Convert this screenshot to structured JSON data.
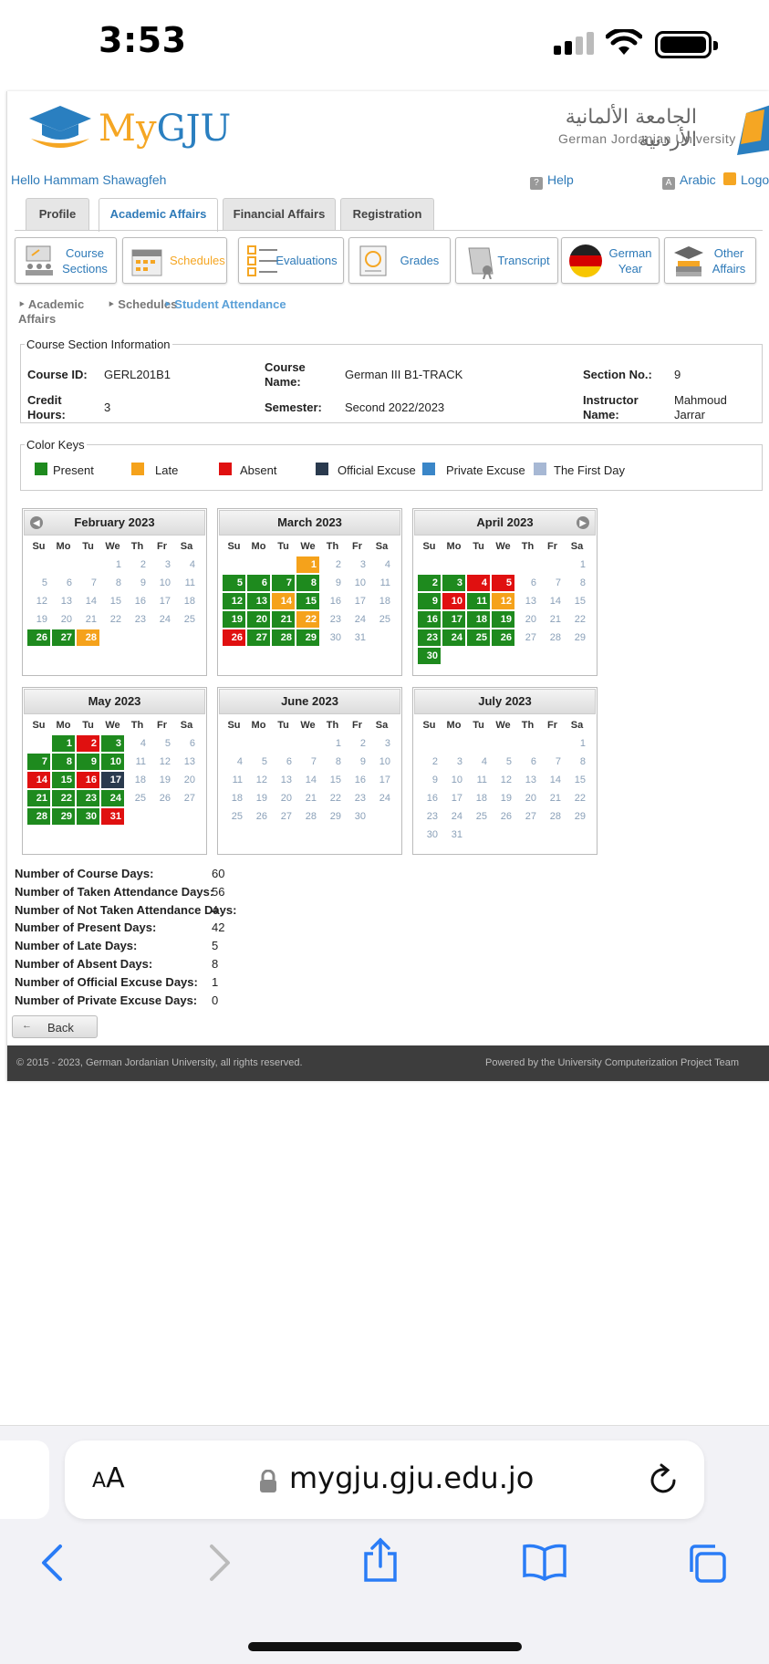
{
  "status_bar": {
    "time": "3:53"
  },
  "header": {
    "logo_my": "My",
    "logo_gju": "GJU",
    "university_ar": "الجامعة الألمانية الأردنية",
    "university_en": "German Jordanian University"
  },
  "user_bar": {
    "greeting": "Hello Hammam Shawagfeh",
    "help": "Help",
    "arabic": "Arabic",
    "logout": "Logo"
  },
  "tabs": [
    {
      "label": "Profile"
    },
    {
      "label": "Academic Affairs",
      "active": true
    },
    {
      "label": "Financial Affairs"
    },
    {
      "label": "Registration"
    }
  ],
  "shortcuts": [
    {
      "label": "Course Sections",
      "icon": "course-sections-icon"
    },
    {
      "label": "Schedules",
      "icon": "calendar-icon"
    },
    {
      "label": "Evaluations",
      "icon": "checklist-icon"
    },
    {
      "label": "Grades",
      "icon": "certificate-icon"
    },
    {
      "label": "Transcript",
      "icon": "scroll-icon"
    },
    {
      "label": "German Year",
      "icon": "german-flag-icon"
    },
    {
      "label": "Other Affairs",
      "icon": "books-icon"
    }
  ],
  "breadcrumb": {
    "item1": "Academic Affairs",
    "item2": "Schedules",
    "current": "Student Attendance"
  },
  "course_info": {
    "legend": "Course Section Information",
    "course_id_label": "Course ID:",
    "course_id": "GERL201B1",
    "course_name_label": "Course Name:",
    "course_name": "German III B1-TRACK",
    "section_label": "Section No.:",
    "section": "9",
    "credit_label": "Credit Hours:",
    "credit": "3",
    "semester_label": "Semester:",
    "semester": "Second 2022/2023",
    "instructor_label": "Instructor Name:",
    "instructor": "Mahmoud Jarrar"
  },
  "color_keys": {
    "legend": "Color Keys",
    "items": [
      {
        "label": "Present",
        "color": "#1e8a1e"
      },
      {
        "label": "Late",
        "color": "#f5a21b"
      },
      {
        "label": "Absent",
        "color": "#e01010"
      },
      {
        "label": "Official Excuse",
        "color": "#2a3a4e"
      },
      {
        "label": "Private Excuse",
        "color": "#3a86c8"
      },
      {
        "label": "The First Day",
        "color": "#a7b8d4"
      }
    ]
  },
  "calendar_days": [
    "Su",
    "Mo",
    "Tu",
    "We",
    "Th",
    "Fr",
    "Sa"
  ],
  "months": [
    {
      "title": "February 2023",
      "start": 3,
      "days": 28,
      "marks": {
        "26": "P",
        "27": "P",
        "28": "L"
      }
    },
    {
      "title": "March 2023",
      "start": 3,
      "days": 31,
      "marks": {
        "1": "L",
        "5": "P",
        "6": "P",
        "7": "P",
        "8": "P",
        "12": "P",
        "13": "P",
        "14": "L",
        "15": "P",
        "19": "P",
        "20": "P",
        "21": "P",
        "22": "L",
        "26": "A",
        "27": "P",
        "28": "P",
        "29": "P"
      }
    },
    {
      "title": "April 2023",
      "start": 6,
      "days": 30,
      "marks": {
        "2": "P",
        "3": "P",
        "4": "A",
        "5": "A",
        "9": "P",
        "10": "A",
        "11": "P",
        "12": "L",
        "16": "P",
        "17": "P",
        "18": "P",
        "19": "P",
        "23": "P",
        "24": "P",
        "25": "P",
        "26": "P",
        "30": "P"
      }
    },
    {
      "title": "May 2023",
      "start": 1,
      "days": 31,
      "marks": {
        "1": "P",
        "2": "A",
        "3": "P",
        "7": "P",
        "8": "P",
        "9": "P",
        "10": "P",
        "14": "A",
        "15": "P",
        "16": "A",
        "17": "O",
        "21": "P",
        "22": "P",
        "23": "P",
        "24": "P",
        "28": "P",
        "29": "P",
        "30": "P",
        "31": "A"
      }
    },
    {
      "title": "June 2023",
      "start": 4,
      "days": 30,
      "marks": {}
    },
    {
      "title": "July 2023",
      "start": 6,
      "days": 31,
      "marks": {}
    }
  ],
  "stats": [
    {
      "label": "Number of Course Days:",
      "value": "60"
    },
    {
      "label": "Number of Taken Attendance Days:",
      "value": "56"
    },
    {
      "label": "Number of Not Taken Attendance Days:",
      "value": "4"
    },
    {
      "label": "Number of Present Days:",
      "value": "42"
    },
    {
      "label": "Number of Late Days:",
      "value": "5"
    },
    {
      "label": "Number of Absent Days:",
      "value": "8"
    },
    {
      "label": "Number of Official Excuse Days:",
      "value": "1"
    },
    {
      "label": "Number of Private Excuse Days:",
      "value": "0"
    }
  ],
  "back_label": "Back",
  "footer": {
    "copyright": "© 2015 - 2023, German Jordanian University, all rights reserved.",
    "powered": "Powered by the University Computerization Project Team"
  },
  "browser": {
    "aa_small": "A",
    "aa_large": "A",
    "url": "mygju.gju.edu.jo"
  },
  "mark_colors": {
    "P": "#1e8a1e",
    "L": "#f5a21b",
    "A": "#e01010",
    "O": "#2a3a4e"
  }
}
